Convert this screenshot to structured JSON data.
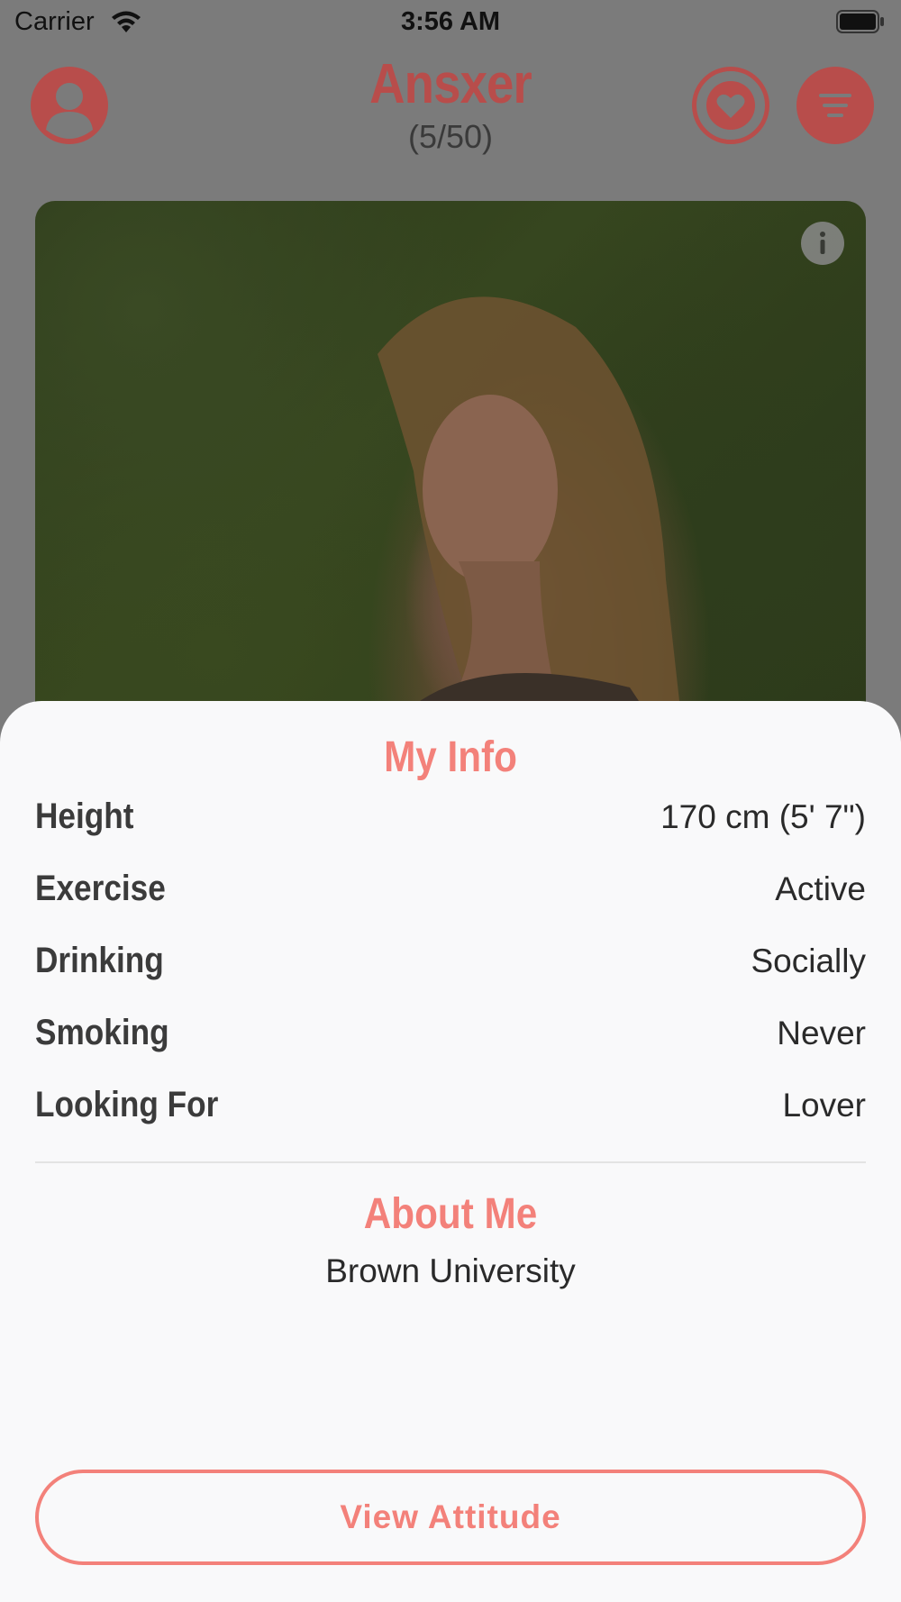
{
  "status_bar": {
    "carrier": "Carrier",
    "time": "3:56 AM"
  },
  "header": {
    "title": "Ansxer",
    "counter": "(5/50)",
    "left_icon": "profile-icon",
    "right_icons": [
      "heart-icon",
      "filter-menu-icon"
    ]
  },
  "photo": {
    "info_icon": "info-icon"
  },
  "my_info": {
    "title": "My Info",
    "rows": [
      {
        "label": "Height",
        "value": "170 cm (5' 7\")"
      },
      {
        "label": "Exercise",
        "value": "Active"
      },
      {
        "label": "Drinking",
        "value": "Socially"
      },
      {
        "label": "Smoking",
        "value": "Never"
      },
      {
        "label": "Looking For",
        "value": "Lover"
      }
    ]
  },
  "about_me": {
    "title": "About Me",
    "text": "Brown University"
  },
  "cta": {
    "label": "View Attitude"
  },
  "colors": {
    "accent": "#f3817a",
    "accent_dimmed": "#b84d4b",
    "sheet_bg": "#f9f9fa",
    "overlay": "#7b7b7b"
  }
}
